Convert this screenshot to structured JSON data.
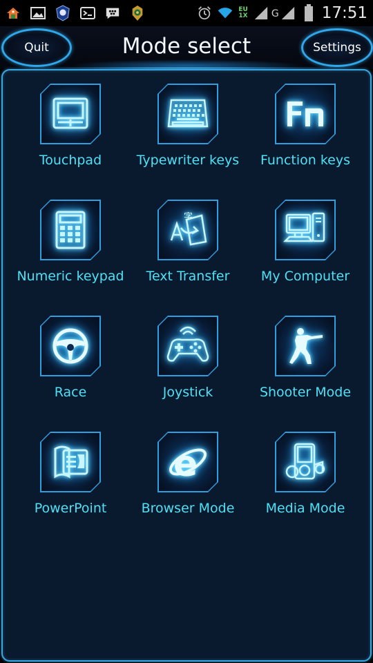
{
  "status_bar": {
    "time": "17:51",
    "network_top": "EU",
    "network_bottom": "1X",
    "network_type": "G",
    "icons": [
      "home-app-icon",
      "gallery-icon",
      "app-badge-icon",
      "bbm-icon",
      "chat-icon",
      "crest-icon",
      "alarm-icon",
      "wifi-icon",
      "signal-icon",
      "signal-g-icon",
      "battery-icon"
    ]
  },
  "header": {
    "title": "Mode select",
    "quit_label": "Quit",
    "settings_label": "Settings"
  },
  "modes": [
    {
      "label": "Touchpad",
      "icon": "touchpad-icon"
    },
    {
      "label": "Typewriter keys",
      "icon": "keyboard-icon"
    },
    {
      "label": "Function keys",
      "icon": "fn-key-icon"
    },
    {
      "label": "Numeric keypad",
      "icon": "calculator-icon"
    },
    {
      "label": "Text Transfer",
      "icon": "text-transfer-icon"
    },
    {
      "label": "My Computer",
      "icon": "computer-icon"
    },
    {
      "label": "Race",
      "icon": "steering-wheel-icon"
    },
    {
      "label": "Joystick",
      "icon": "gamepad-icon"
    },
    {
      "label": "Shooter Mode",
      "icon": "shooter-icon"
    },
    {
      "label": "PowerPoint",
      "icon": "powerpoint-icon"
    },
    {
      "label": "Browser Mode",
      "icon": "browser-icon"
    },
    {
      "label": "Media Mode",
      "icon": "media-player-icon"
    }
  ],
  "colors": {
    "accent": "#2e9fe0",
    "label": "#4fe0f5",
    "panel_bg": "#0a1a2e"
  }
}
